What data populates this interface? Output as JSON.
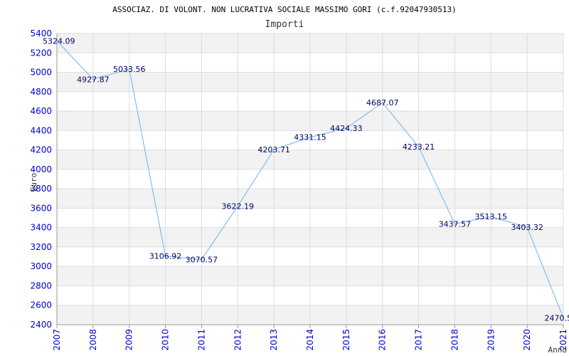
{
  "chart_data": {
    "type": "line",
    "title": "ASSOCIAZ. DI VOLONT. NON LUCRATIVA SOCIALE MASSIMO GORI (c.f.92047930513)",
    "subtitle": "Importi",
    "xlabel": "Anno",
    "ylabel": "Euro",
    "x": [
      "2007",
      "2008",
      "2009",
      "2010",
      "2011",
      "2012",
      "2013",
      "2014",
      "2015",
      "2016",
      "2017",
      "2018",
      "2019",
      "2020",
      "2021"
    ],
    "values": [
      5324.09,
      4927.87,
      5033.56,
      3106.92,
      3070.57,
      3622.19,
      4203.71,
      4331.15,
      4424.33,
      4687.07,
      4233.21,
      3437.57,
      3513.15,
      3403.32,
      2470.5
    ],
    "labels": [
      "5324.09",
      "4927.87",
      "5033.56",
      "3106.92",
      "3070.57",
      "3622.19",
      "4203.71",
      "4331.15",
      "4424.33",
      "4687.07",
      "4233.21",
      "3437.57",
      "3513.15",
      "3403.32",
      "2470.5"
    ],
    "ylim": [
      2400,
      5400
    ],
    "yticks": [
      2400,
      2600,
      2800,
      3000,
      3200,
      3400,
      3600,
      3800,
      4000,
      4200,
      4400,
      4600,
      4800,
      5000,
      5200,
      5400
    ],
    "grid": true,
    "colors": {
      "line": "#6fb3ea",
      "band": "#f2f2f2",
      "grid": "#dddddd",
      "tick_text": "#0000cc",
      "value_text": "#000066",
      "title_text": "#000000"
    }
  }
}
